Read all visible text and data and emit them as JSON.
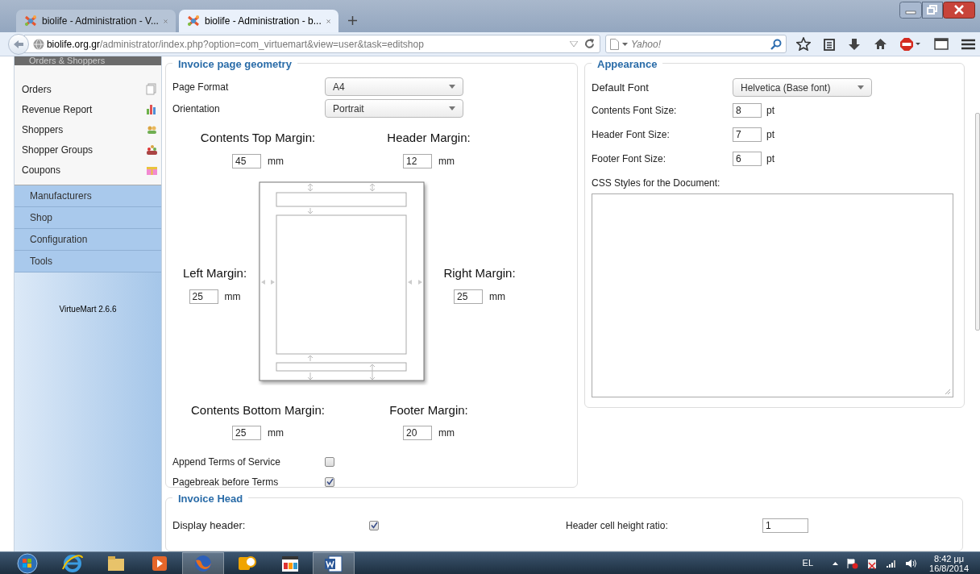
{
  "browser": {
    "tabs": [
      {
        "title": "biolife - Administration - V...",
        "selected": false
      },
      {
        "title": "biolife - Administration - b...",
        "selected": true
      }
    ],
    "url": {
      "host": "biolife.org.gr",
      "path": "/administrator/index.php?option=com_virtuemart&view=user&task=editshop"
    },
    "search": {
      "placeholder": "Yahoo!"
    }
  },
  "sidebar": {
    "section_title": "Orders & Shoppers",
    "items": [
      {
        "label": "Orders",
        "kind": "orders"
      },
      {
        "label": "Revenue Report",
        "kind": "report"
      },
      {
        "label": "Shoppers",
        "kind": "shoppers"
      },
      {
        "label": "Shopper Groups",
        "kind": "groups"
      },
      {
        "label": "Coupons",
        "kind": "coupons"
      }
    ],
    "menu": [
      {
        "label": "Manufacturers"
      },
      {
        "label": "Shop"
      },
      {
        "label": "Configuration"
      },
      {
        "label": "Tools"
      }
    ],
    "version": "VirtueMart 2.6.6"
  },
  "geometry": {
    "title": "Invoice page geometry",
    "selects": [
      {
        "label": "Page Format",
        "value": "A4"
      },
      {
        "label": "Orientation",
        "value": "Portrait"
      }
    ],
    "contents_top": {
      "label": "Contents Top Margin:",
      "value": "45",
      "unit": "mm"
    },
    "header": {
      "label": "Header Margin:",
      "value": "12",
      "unit": "mm"
    },
    "left": {
      "label": "Left Margin:",
      "value": "25",
      "unit": "mm"
    },
    "right": {
      "label": "Right Margin:",
      "value": "25",
      "unit": "mm"
    },
    "contents_bottom": {
      "label": "Contents Bottom Margin:",
      "value": "25",
      "unit": "mm"
    },
    "footer": {
      "label": "Footer Margin:",
      "value": "20",
      "unit": "mm"
    },
    "checkboxes": [
      {
        "label": "Append Terms of Service",
        "checked": false
      },
      {
        "label": "Pagebreak before Terms",
        "checked": true
      }
    ]
  },
  "appearance": {
    "title": "Appearance",
    "default_font": {
      "label": "Default Font",
      "value": "Helvetica (Base font)"
    },
    "sizes": [
      {
        "label": "Contents Font Size:",
        "value": "8",
        "unit": "pt"
      },
      {
        "label": "Header Font Size:",
        "value": "7",
        "unit": "pt"
      },
      {
        "label": "Footer Font Size:",
        "value": "6",
        "unit": "pt"
      }
    ],
    "css_label": "CSS Styles for the Document:"
  },
  "invoice_head": {
    "title": "Invoice Head",
    "display_header": {
      "label": "Display header:",
      "checked": true
    },
    "cell_height_ratio": {
      "label": "Header cell height ratio:",
      "value": "1"
    }
  },
  "taskbar": {
    "language": "EL",
    "time": "8:42 μμ",
    "date": "16/8/2014"
  }
}
